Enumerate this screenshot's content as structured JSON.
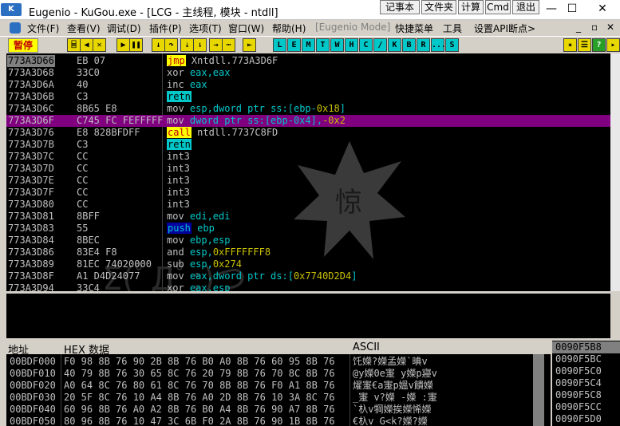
{
  "title": {
    "app_badge": "K",
    "text": "Eugenio - KuGou.exe - [LCG - 主线程, 模块 - ntdll]",
    "buttons": [
      "记事本",
      "文件夹",
      "计算",
      "Cmd",
      "退出"
    ],
    "window_controls": {
      "minimize": "—",
      "restore": "☐",
      "close": "✕"
    }
  },
  "menu": {
    "items": [
      "文件(F)",
      "查看(V)",
      "调试(D)",
      "插件(P)",
      "选项(T)",
      "窗口(W)",
      "帮助(H)",
      "[Eugenio Mode]",
      "快捷菜单",
      "工具",
      "设置API断点>"
    ],
    "mdi_controls": [
      "_",
      "▫",
      "✕"
    ]
  },
  "toolbar": {
    "pause_label": "暂停",
    "letter_buttons": [
      "L",
      "E",
      "M",
      "T",
      "W",
      "H",
      "C",
      "/",
      "K",
      "B",
      "R",
      "...",
      "S"
    ]
  },
  "disasm": {
    "rows": [
      {
        "addr": "773A3D66",
        "hex": "EB 07",
        "asm": [
          {
            "t": "jmp",
            "c": "jmp"
          },
          {
            "t": " Xntdll.773A3D6F",
            "c": "kw"
          }
        ]
      },
      {
        "addr": "773A3D68",
        "hex": "33C0",
        "asm": [
          {
            "t": "xor ",
            "c": "kw"
          },
          {
            "t": "eax,eax",
            "c": "reg"
          }
        ]
      },
      {
        "addr": "773A3D6A",
        "hex": "40",
        "asm": [
          {
            "t": "inc ",
            "c": "kw"
          },
          {
            "t": "eax",
            "c": "reg"
          }
        ]
      },
      {
        "addr": "773A3D6B",
        "hex": "C3",
        "asm": [
          {
            "t": "retn",
            "c": "ret"
          }
        ]
      },
      {
        "addr": "773A3D6C",
        "hex": "8B65 E8",
        "asm": [
          {
            "t": "mov ",
            "c": "kw"
          },
          {
            "t": "esp",
            "c": "reg"
          },
          {
            "t": ",dword ptr ss:[ebp-",
            "c": "reg"
          },
          {
            "t": "0x18",
            "c": "imm"
          },
          {
            "t": "]",
            "c": "reg"
          }
        ]
      },
      {
        "addr": "773A3D6F",
        "hex": "C745 FC FEFFFFF",
        "asm": [
          {
            "t": "mov ",
            "c": "kw"
          },
          {
            "t": "dword ptr ss:[ebp-0x4],",
            "c": "reg"
          },
          {
            "t": "-0x2",
            "c": "imm"
          }
        ],
        "selected": true
      },
      {
        "addr": "773A3D76",
        "hex": "E8 828BFDFF",
        "asm": [
          {
            "t": "call",
            "c": "call"
          },
          {
            "t": " ntdll.7737C8FD",
            "c": "kw"
          }
        ]
      },
      {
        "addr": "773A3D7B",
        "hex": "C3",
        "asm": [
          {
            "t": "retn",
            "c": "ret"
          }
        ]
      },
      {
        "addr": "773A3D7C",
        "hex": "CC",
        "asm": [
          {
            "t": "int3",
            "c": "kw"
          }
        ]
      },
      {
        "addr": "773A3D7D",
        "hex": "CC",
        "asm": [
          {
            "t": "int3",
            "c": "kw"
          }
        ]
      },
      {
        "addr": "773A3D7E",
        "hex": "CC",
        "asm": [
          {
            "t": "int3",
            "c": "kw"
          }
        ]
      },
      {
        "addr": "773A3D7F",
        "hex": "CC",
        "asm": [
          {
            "t": "int3",
            "c": "kw"
          }
        ]
      },
      {
        "addr": "773A3D80",
        "hex": "CC",
        "asm": [
          {
            "t": "int3",
            "c": "kw"
          }
        ]
      },
      {
        "addr": "773A3D81",
        "hex": "8BFF",
        "asm": [
          {
            "t": "mov ",
            "c": "kw"
          },
          {
            "t": "edi,edi",
            "c": "reg"
          }
        ]
      },
      {
        "addr": "773A3D83",
        "hex": "55",
        "asm": [
          {
            "t": "push",
            "c": "push"
          },
          {
            "t": " ebp",
            "c": "reg"
          }
        ]
      },
      {
        "addr": "773A3D84",
        "hex": "8BEC",
        "asm": [
          {
            "t": "mov ",
            "c": "kw"
          },
          {
            "t": "ebp,esp",
            "c": "reg"
          }
        ]
      },
      {
        "addr": "773A3D86",
        "hex": "83E4 F8",
        "asm": [
          {
            "t": "and ",
            "c": "kw"
          },
          {
            "t": "esp,",
            "c": "reg"
          },
          {
            "t": "0xFFFFFFF8",
            "c": "imm"
          }
        ]
      },
      {
        "addr": "773A3D89",
        "hex": "81EC 74020000",
        "asm": [
          {
            "t": "sub ",
            "c": "kw"
          },
          {
            "t": "esp,",
            "c": "reg"
          },
          {
            "t": "0x274",
            "c": "imm"
          }
        ]
      },
      {
        "addr": "773A3D8F",
        "hex": "A1 D4D24077",
        "asm": [
          {
            "t": "mov ",
            "c": "kw"
          },
          {
            "t": "eax,dword ptr ds:[",
            "c": "reg"
          },
          {
            "t": "0x7740D2D4",
            "c": "imm"
          },
          {
            "t": "]",
            "c": "reg"
          }
        ]
      },
      {
        "addr": "773A3D94",
        "hex": "33C4",
        "asm": [
          {
            "t": "xor ",
            "c": "kw"
          },
          {
            "t": "eax,esp",
            "c": "reg"
          }
        ]
      }
    ]
  },
  "watermark": {
    "emoticon": "Σ(ﾟДﾟ;)つ",
    "burst_char": "惊"
  },
  "dump": {
    "header": {
      "addr": "地址",
      "hex": "HEX 数据",
      "ascii": "ASCII"
    },
    "rows": [
      {
        "addr": "00BDF000",
        "hex": "F0 98 8B 76 90 2B 8B 76 B0 A0 8B 76 60 95 8B 76",
        "ascii": "饦嬫?嬫孟嬫`晪v"
      },
      {
        "addr": "00BDF010",
        "hex": "40 79 8B 76 30 65 8C 76 20 79 8B 76 70 8C 8B 76",
        "ascii": "@y嬫0e寁 y嬫p寢v"
      },
      {
        "addr": "00BDF020",
        "hex": "A0 64 8C 76 80 61 8C 76 70 8B 8B 76 F0 A1 8B 76",
        "ascii": "燿寁€a寁p媼v饋嬫"
      },
      {
        "addr": "00BDF030",
        "hex": "20 5F 8C 76 10 A4 8B 76 A0 2D 8B 76 10 3A 8C 76",
        "ascii": " _寁 v?嬫 -嬫 :寁"
      },
      {
        "addr": "00BDF040",
        "hex": "60 96 8B 76 A0 A2 8B 76 B0 A4 8B 76 90 A7 8B 76",
        "ascii": "`杁v犅嬫挨嬫悕嬫"
      },
      {
        "addr": "00BDF050",
        "hex": "80 96 8B 76 10 47 3C 6B F0 2A 8B 76 90 1B 8B 76",
        "ascii": "€杁v G<k?嬫?嬫"
      }
    ]
  },
  "stack": {
    "rows": [
      "0090F5B8",
      "0090F5BC",
      "0090F5C0",
      "0090F5C4",
      "0090F5C8",
      "0090F5CC",
      "0090F5D0"
    ]
  }
}
